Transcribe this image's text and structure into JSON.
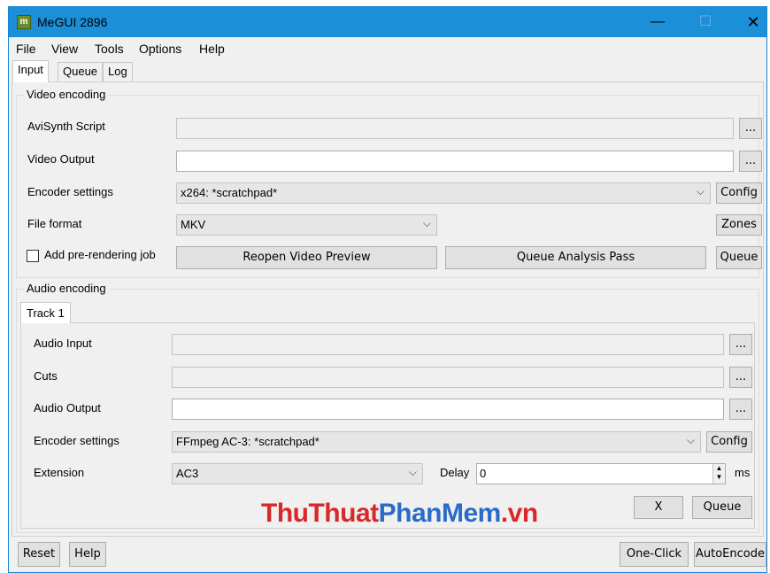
{
  "window": {
    "title": "MeGUI 2896",
    "icon": "megui-app-icon"
  },
  "menu": [
    "File",
    "View",
    "Tools",
    "Options",
    "Help"
  ],
  "tabs": [
    "Input",
    "Queue",
    "Log"
  ],
  "video": {
    "group_title": "Video encoding",
    "avisynth_label": "AviSynth Script",
    "avisynth_value": "",
    "output_label": "Video Output",
    "output_value": "",
    "encoder_label": "Encoder settings",
    "encoder_value": "x264: *scratchpad*",
    "format_label": "File format",
    "format_value": "MKV",
    "browse": "...",
    "config": "Config",
    "zones": "Zones",
    "prerender_label": "Add pre-rendering job",
    "reopen_preview": "Reopen Video Preview",
    "queue_analysis": "Queue Analysis Pass",
    "queue": "Queue"
  },
  "audio": {
    "group_title": "Audio encoding",
    "track_tab": "Track 1",
    "input_label": "Audio Input",
    "cuts_label": "Cuts",
    "output_label": "Audio Output",
    "encoder_label": "Encoder settings",
    "encoder_value": "FFmpeg AC-3: *scratchpad*",
    "extension_label": "Extension",
    "extension_value": "AC3",
    "delay_label": "Delay",
    "delay_value": "0",
    "delay_unit": "ms",
    "browse": "...",
    "config": "Config",
    "remove": "X",
    "queue": "Queue"
  },
  "bottom": {
    "reset": "Reset",
    "help": "Help",
    "one_click": "One-Click",
    "auto_encode": "AutoEncode"
  },
  "watermark": {
    "part1": "ThuThuat",
    "part2": "PhanMem",
    "part3": ".vn"
  }
}
